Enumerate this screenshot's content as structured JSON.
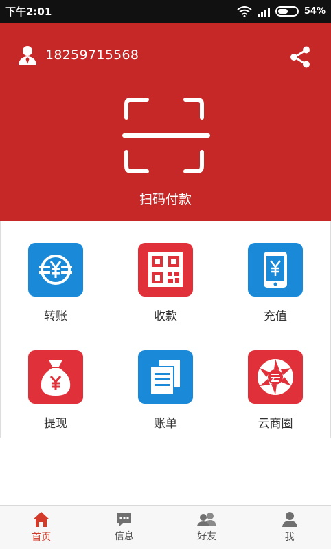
{
  "status_bar": {
    "time": "下午2:01",
    "battery_percent": "54%",
    "battery_level": 0.54
  },
  "header": {
    "phone_number": "18259715568",
    "scan_label": "扫码付款",
    "background_color": "#c62828"
  },
  "grid": {
    "items": [
      {
        "label": "转账",
        "icon": "transfer-yen-icon",
        "color": "#1a8ad8"
      },
      {
        "label": "收款",
        "icon": "qr-code-icon",
        "color": "#e0313a"
      },
      {
        "label": "充值",
        "icon": "phone-recharge-icon",
        "color": "#1a8ad8"
      },
      {
        "label": "提现",
        "icon": "money-bag-icon",
        "color": "#e0313a"
      },
      {
        "label": "账单",
        "icon": "bill-documents-icon",
        "color": "#1a8ad8"
      },
      {
        "label": "云商圈",
        "icon": "aperture-icon",
        "color": "#e0313a"
      }
    ]
  },
  "bottom_nav": {
    "items": [
      {
        "label": "首页",
        "icon": "home-icon",
        "active": true
      },
      {
        "label": "信息",
        "icon": "message-icon",
        "active": false
      },
      {
        "label": "好友",
        "icon": "friends-icon",
        "active": false
      },
      {
        "label": "我",
        "icon": "profile-icon",
        "active": false
      }
    ],
    "active_color": "#d23a2a"
  }
}
